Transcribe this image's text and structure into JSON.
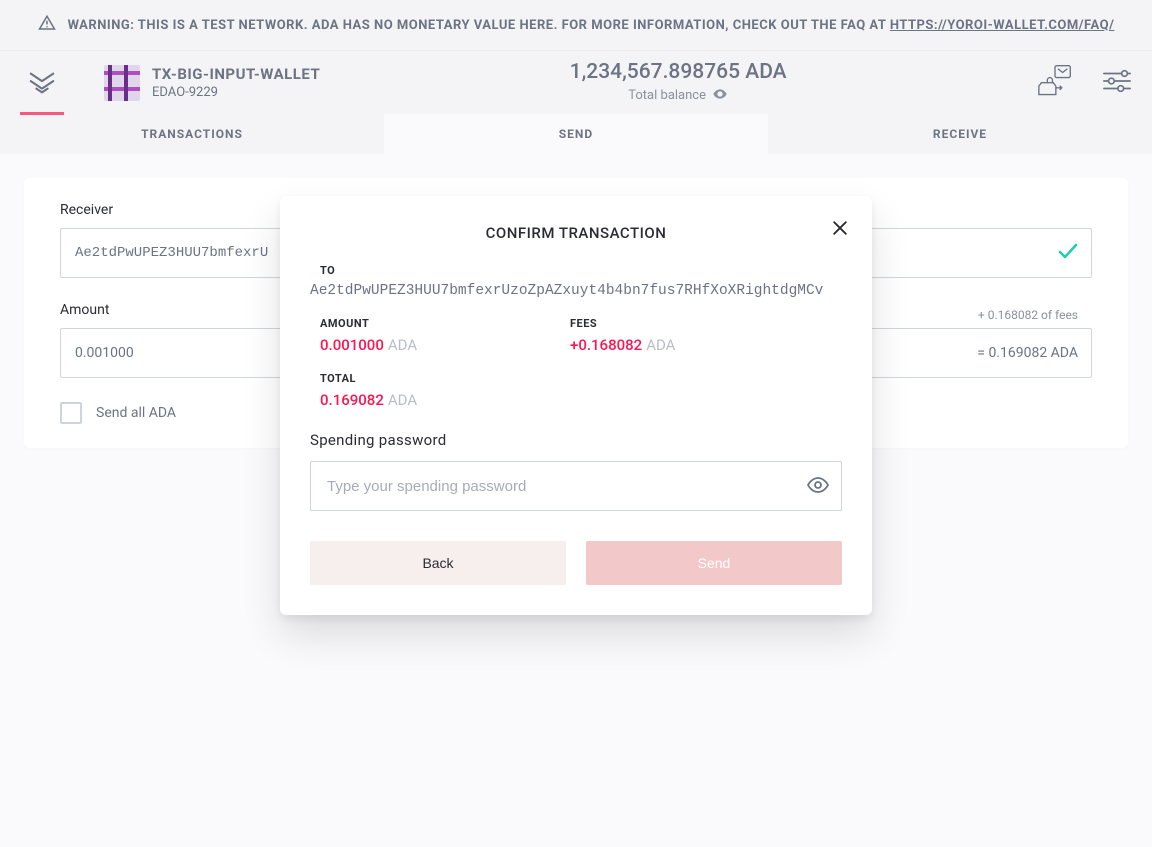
{
  "warning": {
    "prefix": "WARNING: THIS IS A TEST NETWORK. ADA HAS NO MONETARY VALUE HERE. FOR MORE INFORMATION, CHECK OUT THE FAQ AT ",
    "link_text": "HTTPS://YOROI-WALLET.COM/FAQ/"
  },
  "header": {
    "wallet_name": "TX-BIG-INPUT-WALLET",
    "wallet_sub": "EDAO-9229",
    "balance_amount": "1,234,567.898765 ADA",
    "balance_label": "Total balance"
  },
  "tabs": {
    "transactions": "TRANSACTIONS",
    "send": "SEND",
    "receive": "RECEIVE"
  },
  "form": {
    "receiver_label": "Receiver",
    "receiver_value": "Ae2tdPwUPEZ3HUU7bmfexrU",
    "amount_label": "Amount",
    "amount_value": "0.001000",
    "fees_hint": "+ 0.168082 of fees",
    "total_hint": "= 0.169082 ADA",
    "sendall_label": "Send all ADA"
  },
  "modal": {
    "title": "CONFIRM TRANSACTION",
    "to_label": "TO",
    "to_value": "Ae2tdPwUPEZ3HUU7bmfexrUzoZpAZxuyt4b4bn7fus7RHfXoXRightdgMCv",
    "amount_label": "AMOUNT",
    "amount_value": "0.001000",
    "amount_unit": "ADA",
    "fees_label": "FEES",
    "fees_value": "+0.168082",
    "fees_unit": "ADA",
    "total_label": "TOTAL",
    "total_value": "0.169082",
    "total_unit": "ADA",
    "sp_label": "Spending password",
    "sp_placeholder": "Type your spending password",
    "back_label": "Back",
    "send_label": "Send"
  }
}
